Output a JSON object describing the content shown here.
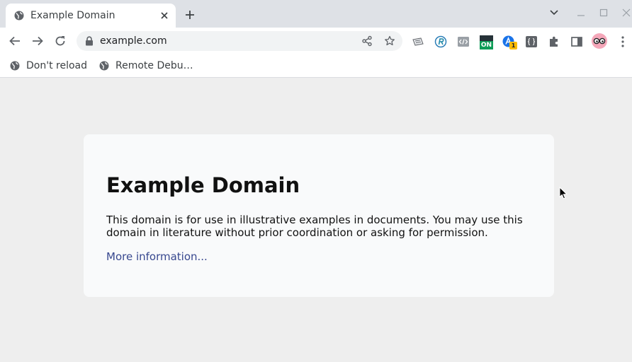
{
  "tab": {
    "title": "Example Domain"
  },
  "omnibox": {
    "url": "example.com"
  },
  "bookmarks": [
    {
      "label": "Don't reload"
    },
    {
      "label": "Remote Debu…"
    }
  ],
  "page": {
    "heading": "Example Domain",
    "body": "This domain is for use in illustrative examples in documents. You may use this domain in literature without prior coordination or asking for permission.",
    "link": "More information..."
  },
  "extensions": {
    "badge_on": "ON",
    "badge_count": "1"
  },
  "colors": {
    "tabstrip": "#dee1e6",
    "link": "#38488f",
    "card": "#f9fafb",
    "page_bg": "#eeeeee"
  }
}
